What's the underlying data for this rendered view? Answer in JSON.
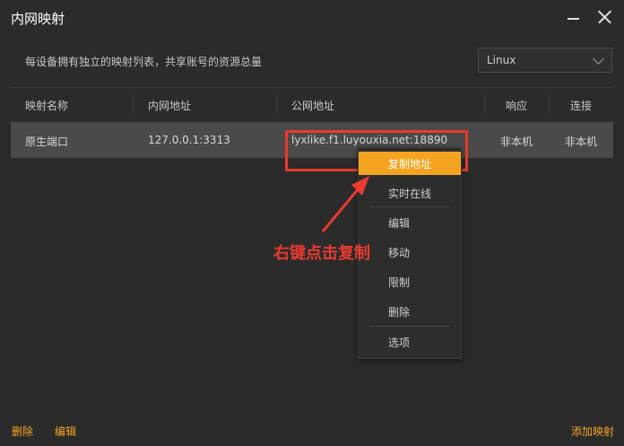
{
  "window": {
    "title": "内网映射"
  },
  "description": "每设备拥有独立的映射列表，共享账号的资源总量",
  "os_select": {
    "value": "Linux"
  },
  "table": {
    "headers": [
      "映射名称",
      "内网地址",
      "公网地址",
      "响应",
      "连接"
    ],
    "rows": [
      {
        "name": "原生端口",
        "local": "127.0.0.1:3313",
        "public": "lyxlike.f1.luyouxia.net:18890",
        "response": "非本机",
        "connection": "非本机"
      }
    ]
  },
  "context_menu": {
    "items": [
      "复制地址",
      "实时在线",
      "编辑",
      "移动",
      "限制",
      "删除",
      "选项"
    ],
    "active": "复制地址"
  },
  "annotation": "右键点击复制",
  "footer": {
    "delete": "删除",
    "edit": "编辑",
    "add": "添加映射"
  },
  "colors": {
    "accent": "#f5a421",
    "annotation": "#e83a30",
    "background": "#2b2b2b",
    "row_selected": "#4a4a4a"
  }
}
